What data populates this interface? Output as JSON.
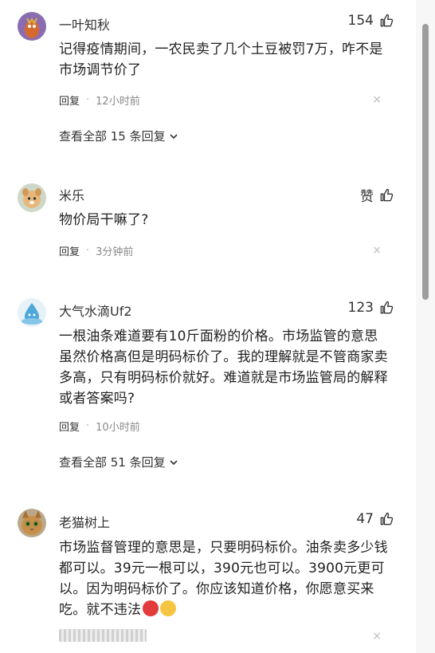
{
  "comments": [
    {
      "name": "一叶知秋",
      "likes": "154",
      "text_line1": "记得疫情期间，一农民卖了几个土豆被罚7万，咋不是",
      "text_line2": "市场调节价了",
      "reply": "回复",
      "time": "12小时前",
      "more": "查看全部 15 条回复"
    },
    {
      "name": "米乐",
      "likes": "赞",
      "text_line1": "物价局干嘛了?",
      "reply": "回复",
      "time": "3分钟前"
    },
    {
      "name": "大气水滴Uf2",
      "likes": "123",
      "text_line1": "一根油条难道要有10斤面粉的价格。市场监管的意思",
      "text_line2": "虽然价格高但是明码标价了。我的理解就是不管商家卖",
      "text_line3": "多高，只有明码标价就好。难道就是市场监管局的解释",
      "text_line4": "或者答案吗?",
      "reply": "回复",
      "time": "10小时前",
      "more": "查看全部 51 条回复"
    },
    {
      "name": "老猫树上",
      "likes": "47",
      "text_line1": "市场监督管理的意思是，只要明码标价。油条卖多少钱",
      "text_line2": "都可以。39元一根可以，390元也可以。3900元更可",
      "text_line3": "以。因为明码标价了。你应该知道价格，你愿意买来",
      "text_line4": "吃。就不违法"
    }
  ],
  "icons": {
    "like": "thumbs-up-icon",
    "close": "close-icon",
    "chevron": "chevron-down-icon"
  },
  "close_glyph": "×",
  "colors": {
    "accent": "#333333",
    "muted": "#888888"
  }
}
